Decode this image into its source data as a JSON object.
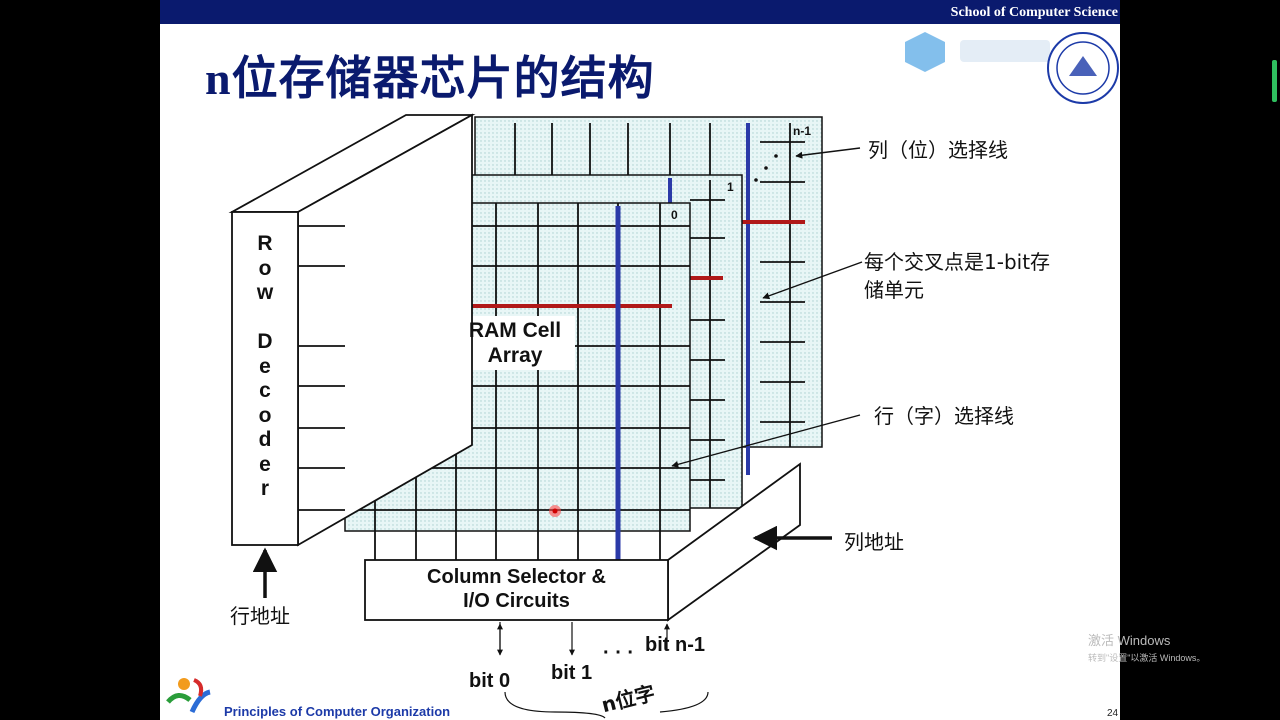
{
  "header": {
    "school": "School of Computer Science"
  },
  "title": "n位存储器芯片的结构",
  "diagram": {
    "row_decoder": "R\no\nw\n \nD\ne\nc\no\nd\ne\nr",
    "ram_cell_array_line1": "RAM Cell",
    "ram_cell_array_line2": "Array",
    "column_selector_line1": "Column Selector &",
    "column_selector_line2": "I/O Circuits",
    "plane_labels": [
      "0",
      "1",
      "n-1"
    ],
    "bit_labels": [
      "bit 0",
      "bit 1",
      "bit n-1"
    ],
    "bit_dots": "· · ·",
    "n_bit_word": "n位字"
  },
  "annotations": {
    "column_select_line": "列（位）选择线",
    "cross_point_line1": "每个交叉点是1-bit存",
    "cross_point_line2": "储单元",
    "row_select_line": "行（字）选择线",
    "column_address": "列地址",
    "row_address": "行地址"
  },
  "footer": {
    "course": "Principles of Computer Organization",
    "page": "24"
  },
  "watermark": {
    "line1": "激活 Windows",
    "line2": "转到\"设置\"以激活 Windows。"
  },
  "colors": {
    "header_bar": "#0a1a6e",
    "title": "#0a1a6e",
    "row_line": "#b01818",
    "column_line": "#2b3aa8",
    "array_fill": "#e2f3f3",
    "footer_text": "#1c3aa8"
  }
}
